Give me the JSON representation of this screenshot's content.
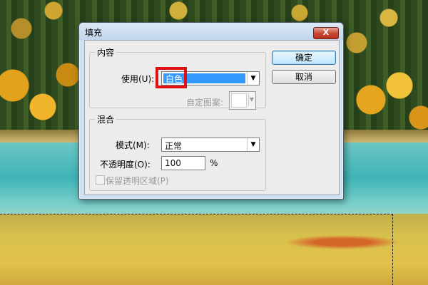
{
  "dialog": {
    "title": "填充",
    "close_label": "X"
  },
  "content_group": {
    "legend": "内容",
    "use_label": "使用(U):",
    "use_value": "白色",
    "pattern_label": "自定图案:"
  },
  "blend_group": {
    "legend": "混合",
    "mode_label": "模式(M):",
    "mode_value": "正常",
    "opacity_label": "不透明度(O):",
    "opacity_value": "100",
    "opacity_unit": "%",
    "preserve_label": "保留透明区域(P)",
    "preserve_checked": false
  },
  "buttons": {
    "ok": "确定",
    "cancel": "取消"
  },
  "icons": {
    "dropdown": "chevron-down-icon",
    "close": "close-icon"
  },
  "colors": {
    "selection_highlight": "#3399ff",
    "annotation_box": "#e01010"
  }
}
